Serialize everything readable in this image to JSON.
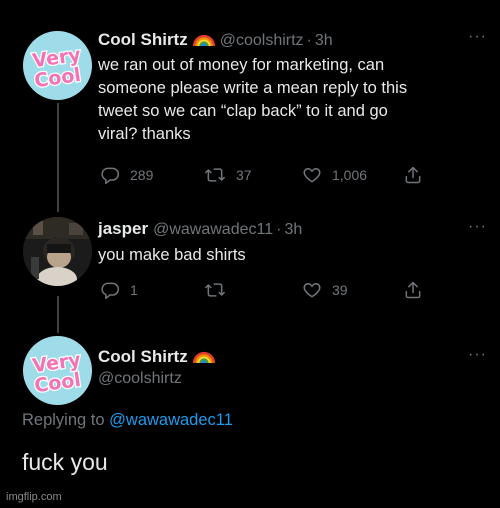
{
  "tweet1": {
    "name": "Cool Shirtz",
    "handle": "@coolshirtz",
    "time": "3h",
    "text_lines": [
      "we ran out of money for marketing, can",
      "someone please write a mean reply to this",
      "tweet so we can “clap back” to it and go",
      "viral? thanks"
    ],
    "replies": "289",
    "retweets": "37",
    "likes": "1,006",
    "avatar_text": [
      "Very",
      "Cool"
    ]
  },
  "tweet2": {
    "name": "jasper",
    "handle": "@wawawadec11",
    "time": "3h",
    "text": "you make bad shirts",
    "replies": "1",
    "likes": "39"
  },
  "tweet3": {
    "name": "Cool Shirtz",
    "handle": "@coolshirtz",
    "replying_label": "Replying to",
    "replying_handle": "@wawawadec11",
    "text": "fuck you",
    "avatar_text": [
      "Very",
      "Cool"
    ]
  },
  "separator": "·",
  "more_label": "···",
  "watermark": "imgflip.com",
  "colors": {
    "background": "#000000",
    "text": "#e7e9ea",
    "muted": "#71767b",
    "link": "#1d9bf0",
    "avatar_bg": "#9fdcea",
    "avatar_text": "#f472b6"
  },
  "icons": [
    "reply-icon",
    "retweet-icon",
    "like-icon",
    "share-icon",
    "rainbow-emoji-icon",
    "more-icon"
  ]
}
